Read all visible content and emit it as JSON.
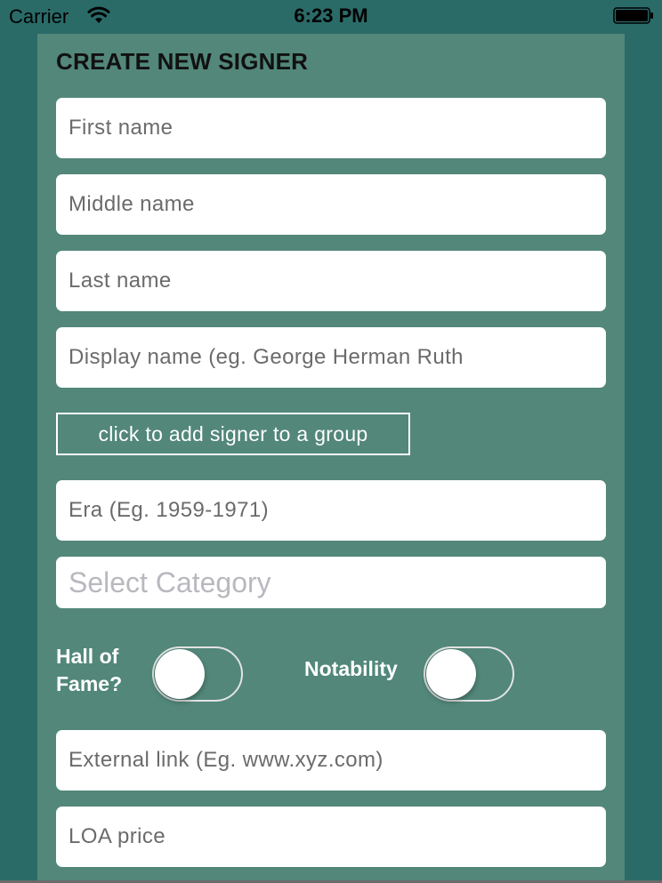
{
  "status_bar": {
    "carrier": "Carrier",
    "time": "6:23 PM",
    "wifi_icon": "wifi-icon",
    "battery_icon": "battery-icon"
  },
  "form": {
    "title": "CREATE NEW SIGNER",
    "first_name_placeholder": "First name",
    "middle_name_placeholder": "Middle name",
    "last_name_placeholder": "Last name",
    "display_name_placeholder": "Display name (eg. George Herman Ruth",
    "group_button_label": "click to add signer to a group",
    "era_placeholder": "Era (Eg. 1959-1971)",
    "category_placeholder": "Select Category",
    "hall_of_fame_label_line1": "Hall of",
    "hall_of_fame_label_line2": "Fame?",
    "notability_label": "Notability",
    "external_link_placeholder": "External link (Eg. www.xyz.com)",
    "loa_price_placeholder": "LOA price"
  },
  "colors": {
    "background": "#2a6b68",
    "panel": "#528779"
  }
}
